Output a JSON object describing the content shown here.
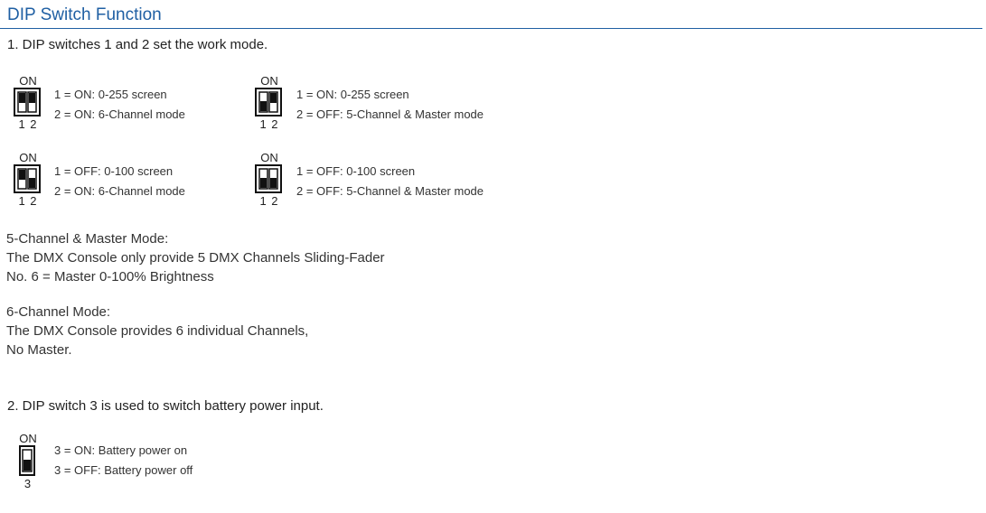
{
  "title": "DIP Switch Function",
  "section1": {
    "heading": "1. DIP switches 1 and 2 set the work mode.",
    "on_label": "ON",
    "numbers": "1 2",
    "options": [
      {
        "switch1": "up",
        "switch2": "up",
        "line1": "1 = ON: 0-255 screen",
        "line2": "2 = ON: 6-Channel mode"
      },
      {
        "switch1": "down",
        "switch2": "up",
        "line1": "1 = ON: 0-255 screen",
        "line2": "2 = OFF: 5-Channel & Master mode"
      },
      {
        "switch1": "up",
        "switch2": "down",
        "line1": "1 = OFF: 0-100 screen",
        "line2": "2 = ON: 6-Channel mode"
      },
      {
        "switch1": "down",
        "switch2": "down",
        "line1": "1 = OFF: 0-100 screen",
        "line2": "2 = OFF: 5-Channel & Master mode"
      }
    ]
  },
  "modes": {
    "five_channel": {
      "title": "5-Channel & Master Mode:",
      "line1": "The DMX Console only provide 5 DMX Channels Sliding-Fader",
      "line2": "No. 6 = Master 0-100% Brightness"
    },
    "six_channel": {
      "title": "6-Channel Mode:",
      "line1": "The DMX Console provides 6 individual Channels,",
      "line2": "No Master."
    }
  },
  "section2": {
    "heading": "2. DIP switch 3 is used to switch battery power input.",
    "on_label": "ON",
    "number": "3",
    "switch": "down",
    "line1": "3 = ON: Battery power on",
    "line2": "3 = OFF: Battery power off"
  }
}
